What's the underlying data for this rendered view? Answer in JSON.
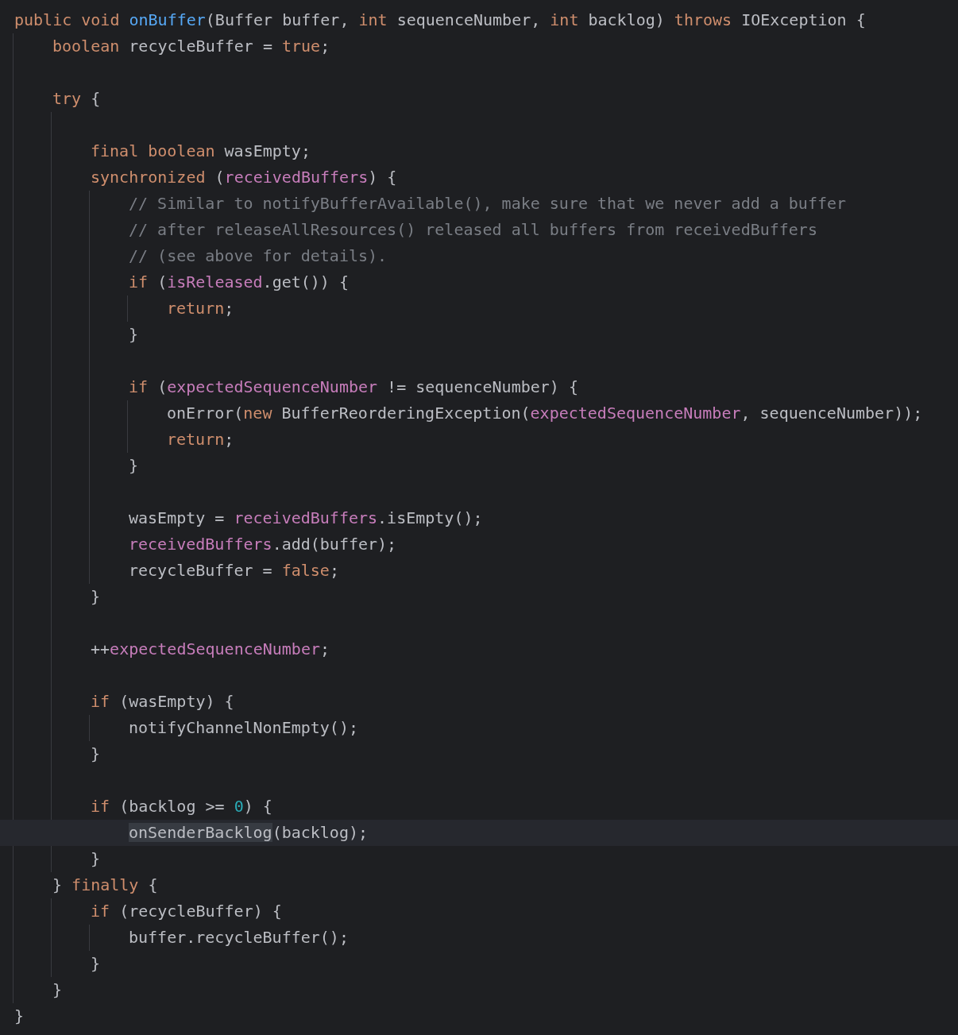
{
  "editor": {
    "lines": [
      {
        "kind": "code",
        "current": false,
        "tokens": [
          {
            "text": "public void ",
            "kind": "keyword"
          },
          {
            "text": "onBuffer",
            "kind": "method"
          },
          {
            "text": "(Buffer buffer, ",
            "kind": "plain"
          },
          {
            "text": "int ",
            "kind": "keyword"
          },
          {
            "text": "sequenceNumber, ",
            "kind": "plain"
          },
          {
            "text": "int ",
            "kind": "keyword"
          },
          {
            "text": "backlog) ",
            "kind": "plain"
          },
          {
            "text": "throws ",
            "kind": "keyword"
          },
          {
            "text": "IOException {",
            "kind": "plain"
          }
        ],
        "children": [
          {
            "kind": "code",
            "current": false,
            "tokens": [
              {
                "text": "boolean ",
                "kind": "keyword"
              },
              {
                "text": "recycleBuffer = ",
                "kind": "plain"
              },
              {
                "text": "true",
                "kind": "keyword"
              },
              {
                "text": ";",
                "kind": "plain"
              }
            ]
          },
          {
            "kind": "blank",
            "current": false
          },
          {
            "kind": "code",
            "current": false,
            "tokens": [
              {
                "text": "try ",
                "kind": "keyword"
              },
              {
                "text": "{",
                "kind": "plain"
              }
            ],
            "children": [
              {
                "kind": "blank",
                "current": false
              },
              {
                "kind": "code",
                "current": false,
                "tokens": [
                  {
                    "text": "final boolean ",
                    "kind": "keyword"
                  },
                  {
                    "text": "wasEmpty;",
                    "kind": "plain"
                  }
                ]
              },
              {
                "kind": "code",
                "current": false,
                "tokens": [
                  {
                    "text": "synchronized ",
                    "kind": "keyword"
                  },
                  {
                    "text": "(",
                    "kind": "plain"
                  },
                  {
                    "text": "receivedBuffers",
                    "kind": "field"
                  },
                  {
                    "text": ") {",
                    "kind": "plain"
                  }
                ],
                "children": [
                  {
                    "kind": "code",
                    "current": false,
                    "tokens": [
                      {
                        "text": "// Similar to notifyBufferAvailable(), make sure that we never add a buffer",
                        "kind": "comment"
                      }
                    ]
                  },
                  {
                    "kind": "code",
                    "current": false,
                    "tokens": [
                      {
                        "text": "// after releaseAllResources() released all buffers from receivedBuffers",
                        "kind": "comment"
                      }
                    ]
                  },
                  {
                    "kind": "code",
                    "current": false,
                    "tokens": [
                      {
                        "text": "// (see above for details).",
                        "kind": "comment"
                      }
                    ]
                  },
                  {
                    "kind": "code",
                    "current": false,
                    "tokens": [
                      {
                        "text": "if ",
                        "kind": "keyword"
                      },
                      {
                        "text": "(",
                        "kind": "plain"
                      },
                      {
                        "text": "isReleased",
                        "kind": "field"
                      },
                      {
                        "text": ".get()) {",
                        "kind": "plain"
                      }
                    ],
                    "children": [
                      {
                        "kind": "code",
                        "current": false,
                        "tokens": [
                          {
                            "text": "return",
                            "kind": "keyword"
                          },
                          {
                            "text": ";",
                            "kind": "plain"
                          }
                        ]
                      }
                    ]
                  },
                  {
                    "kind": "code",
                    "current": false,
                    "tokens": [
                      {
                        "text": "}",
                        "kind": "plain"
                      }
                    ]
                  },
                  {
                    "kind": "blank",
                    "current": false
                  },
                  {
                    "kind": "code",
                    "current": false,
                    "tokens": [
                      {
                        "text": "if ",
                        "kind": "keyword"
                      },
                      {
                        "text": "(",
                        "kind": "plain"
                      },
                      {
                        "text": "expectedSequenceNumber",
                        "kind": "field"
                      },
                      {
                        "text": " != sequenceNumber) {",
                        "kind": "plain"
                      }
                    ],
                    "children": [
                      {
                        "kind": "code",
                        "current": false,
                        "tokens": [
                          {
                            "text": "onError(",
                            "kind": "plain"
                          },
                          {
                            "text": "new ",
                            "kind": "keyword"
                          },
                          {
                            "text": "BufferReorderingException(",
                            "kind": "plain"
                          },
                          {
                            "text": "expectedSequenceNumber",
                            "kind": "field"
                          },
                          {
                            "text": ", sequenceNumber));",
                            "kind": "plain"
                          }
                        ]
                      },
                      {
                        "kind": "code",
                        "current": false,
                        "tokens": [
                          {
                            "text": "return",
                            "kind": "keyword"
                          },
                          {
                            "text": ";",
                            "kind": "plain"
                          }
                        ]
                      }
                    ]
                  },
                  {
                    "kind": "code",
                    "current": false,
                    "tokens": [
                      {
                        "text": "}",
                        "kind": "plain"
                      }
                    ]
                  },
                  {
                    "kind": "blank",
                    "current": false
                  },
                  {
                    "kind": "code",
                    "current": false,
                    "tokens": [
                      {
                        "text": "wasEmpty = ",
                        "kind": "plain"
                      },
                      {
                        "text": "receivedBuffers",
                        "kind": "field"
                      },
                      {
                        "text": ".isEmpty();",
                        "kind": "plain"
                      }
                    ]
                  },
                  {
                    "kind": "code",
                    "current": false,
                    "tokens": [
                      {
                        "text": "receivedBuffers",
                        "kind": "field"
                      },
                      {
                        "text": ".add(buffer);",
                        "kind": "plain"
                      }
                    ]
                  },
                  {
                    "kind": "code",
                    "current": false,
                    "tokens": [
                      {
                        "text": "recycleBuffer = ",
                        "kind": "plain"
                      },
                      {
                        "text": "false",
                        "kind": "keyword"
                      },
                      {
                        "text": ";",
                        "kind": "plain"
                      }
                    ]
                  }
                ]
              },
              {
                "kind": "code",
                "current": false,
                "tokens": [
                  {
                    "text": "}",
                    "kind": "plain"
                  }
                ]
              },
              {
                "kind": "blank",
                "current": false
              },
              {
                "kind": "code",
                "current": false,
                "tokens": [
                  {
                    "text": "++",
                    "kind": "plain"
                  },
                  {
                    "text": "expectedSequenceNumber",
                    "kind": "field"
                  },
                  {
                    "text": ";",
                    "kind": "plain"
                  }
                ]
              },
              {
                "kind": "blank",
                "current": false
              },
              {
                "kind": "code",
                "current": false,
                "tokens": [
                  {
                    "text": "if ",
                    "kind": "keyword"
                  },
                  {
                    "text": "(wasEmpty) {",
                    "kind": "plain"
                  }
                ],
                "children": [
                  {
                    "kind": "code",
                    "current": false,
                    "tokens": [
                      {
                        "text": "notifyChannelNonEmpty();",
                        "kind": "plain"
                      }
                    ]
                  }
                ]
              },
              {
                "kind": "code",
                "current": false,
                "tokens": [
                  {
                    "text": "}",
                    "kind": "plain"
                  }
                ]
              },
              {
                "kind": "blank",
                "current": false
              },
              {
                "kind": "code",
                "current": false,
                "tokens": [
                  {
                    "text": "if ",
                    "kind": "keyword"
                  },
                  {
                    "text": "(backlog >= ",
                    "kind": "plain"
                  },
                  {
                    "text": "0",
                    "kind": "number"
                  },
                  {
                    "text": ") {",
                    "kind": "plain"
                  }
                ],
                "children": [
                  {
                    "kind": "code",
                    "current": true,
                    "tokens": [
                      {
                        "text": "onSenderBacklog",
                        "kind": "selection"
                      },
                      {
                        "text": "(backlog);",
                        "kind": "plain"
                      }
                    ]
                  }
                ]
              },
              {
                "kind": "code",
                "current": false,
                "tokens": [
                  {
                    "text": "}",
                    "kind": "plain"
                  }
                ]
              }
            ]
          },
          {
            "kind": "code",
            "current": false,
            "tokens": [
              {
                "text": "} ",
                "kind": "plain"
              },
              {
                "text": "finally ",
                "kind": "keyword"
              },
              {
                "text": "{",
                "kind": "plain"
              }
            ],
            "children": [
              {
                "kind": "code",
                "current": false,
                "tokens": [
                  {
                    "text": "if ",
                    "kind": "keyword"
                  },
                  {
                    "text": "(recycleBuffer) {",
                    "kind": "plain"
                  }
                ],
                "children": [
                  {
                    "kind": "code",
                    "current": false,
                    "tokens": [
                      {
                        "text": "buffer.recycleBuffer();",
                        "kind": "plain"
                      }
                    ]
                  }
                ]
              },
              {
                "kind": "code",
                "current": false,
                "tokens": [
                  {
                    "text": "}",
                    "kind": "plain"
                  }
                ]
              }
            ]
          },
          {
            "kind": "code",
            "current": false,
            "tokens": [
              {
                "text": "}",
                "kind": "plain"
              }
            ]
          }
        ]
      },
      {
        "kind": "code",
        "current": false,
        "tokens": [
          {
            "text": "}",
            "kind": "plain"
          }
        ]
      }
    ]
  }
}
